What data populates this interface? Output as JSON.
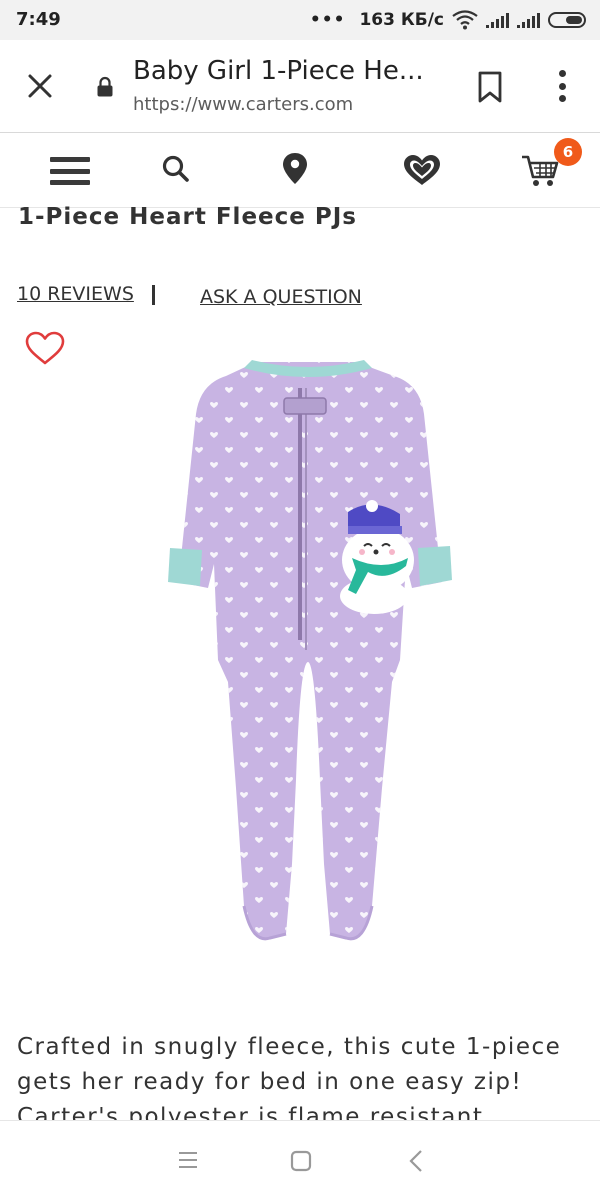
{
  "status_bar": {
    "time": "7:49",
    "data_rate": "163 КБ/с",
    "dots": "•••"
  },
  "browser": {
    "title": "Baby Girl 1-Piece He...",
    "url": "https://www.carters.com"
  },
  "site_nav": {
    "cart_count": "6",
    "accent_color": "#f05a1a"
  },
  "product": {
    "title": "1-Piece Heart Fleece PJs",
    "reviews_label": "10 REVIEWS",
    "ask_label": "ASK A QUESTION",
    "description": "Crafted in snugly fleece, this cute 1-piece gets her ready for bed in one easy zip! Carter's polyester is flame resistant"
  },
  "icons": {
    "close": "close-icon",
    "lock": "lock-icon",
    "bookmark": "bookmark-icon",
    "menu": "more-vert-icon",
    "nav_menu": "hamburger-icon",
    "search": "search-icon",
    "location": "location-pin-icon",
    "favorites": "heart-icon",
    "cart": "cart-icon",
    "wishlist": "heart-outline-icon",
    "android_menu": "menu-lines-icon",
    "android_home": "home-square-icon",
    "android_back": "back-chevron-icon"
  },
  "colors": {
    "pajama": "#c8b4e3",
    "trim": "#9fd8d4",
    "heart_outline": "#e03c3c"
  }
}
